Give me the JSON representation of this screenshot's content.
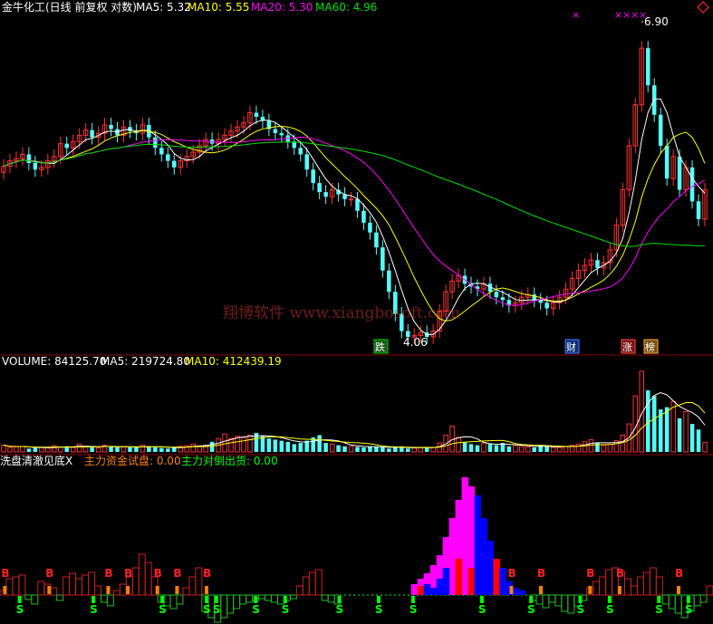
{
  "colors": {
    "up": "#ff3232",
    "down": "#54fcfc",
    "ma5": "#ffffff",
    "ma10": "#ffff00",
    "ma20": "#ff00ff",
    "ma60": "#00e000",
    "header_label": "#ffffff",
    "label_green": "#00ff00",
    "label_orange": "#ff8000",
    "label_cyan": "#54fcfc",
    "diamond_red": "#ff2020",
    "pivot_blue": "#0000ff"
  },
  "chart_data": [
    {
      "type": "candlestick",
      "title": "金牛化工(日线 前复权 对数)",
      "scale": "log",
      "ylim": [
        4.06,
        6.9
      ],
      "ma_legend": [
        {
          "name": "MA5",
          "value": "5.32",
          "color": "#ffffff"
        },
        {
          "name": "MA10",
          "value": "5.55",
          "color": "#ffff00"
        },
        {
          "name": "MA20",
          "value": "5.30",
          "color": "#ff00ff"
        },
        {
          "name": "MA60",
          "value": "4.96",
          "color": "#00e000"
        }
      ],
      "high_label": "6.90",
      "low_label": "4.06",
      "close": [
        5.41,
        5.46,
        5.48,
        5.52,
        5.44,
        5.38,
        5.4,
        5.46,
        5.5,
        5.62,
        5.58,
        5.64,
        5.7,
        5.75,
        5.68,
        5.72,
        5.8,
        5.76,
        5.7,
        5.78,
        5.74,
        5.72,
        5.8,
        5.68,
        5.58,
        5.52,
        5.46,
        5.4,
        5.46,
        5.5,
        5.54,
        5.6,
        5.66,
        5.62,
        5.66,
        5.7,
        5.74,
        5.78,
        5.82,
        5.92,
        5.88,
        5.84,
        5.76,
        5.72,
        5.7,
        5.64,
        5.58,
        5.52,
        5.38,
        5.26,
        5.18,
        5.14,
        5.2,
        5.16,
        5.12,
        5.12,
        5.02,
        4.92,
        4.84,
        4.72,
        4.54,
        4.38,
        4.22,
        4.1,
        4.06,
        4.07,
        4.09,
        4.06,
        4.1,
        4.24,
        4.38,
        4.46,
        4.5,
        4.44,
        4.42,
        4.4,
        4.44,
        4.38,
        4.34,
        4.32,
        4.28,
        4.3,
        4.34,
        4.36,
        4.32,
        4.3,
        4.26,
        4.3,
        4.34,
        4.4,
        4.48,
        4.54,
        4.58,
        4.62,
        4.56,
        4.6,
        4.7,
        4.9,
        5.2,
        5.6,
        6.0,
        6.6,
        6.2,
        5.9,
        5.6,
        5.3,
        5.5,
        5.2,
        5.4,
        5.1,
        4.95,
        5.2
      ],
      "volume": {
        "legend": [
          {
            "name": "VOLUME",
            "value": "84125.70",
            "color": "#ffffff"
          },
          {
            "name": "MA5",
            "value": "219724.80",
            "color": "#ffffff"
          },
          {
            "name": "MA10",
            "value": "412439.19",
            "color": "#ffff00"
          }
        ],
        "values": [
          60,
          40,
          45,
          50,
          30,
          35,
          40,
          35,
          55,
          45,
          50,
          40,
          70,
          45,
          40,
          35,
          60,
          50,
          40,
          45,
          40,
          40,
          60,
          50,
          40,
          35,
          30,
          40,
          50,
          55,
          70,
          50,
          60,
          90,
          120,
          160,
          120,
          140,
          130,
          150,
          170,
          140,
          120,
          110,
          100,
          90,
          70,
          80,
          100,
          130,
          150,
          80,
          70,
          60,
          50,
          50,
          45,
          40,
          50,
          45,
          40,
          30,
          40,
          50,
          30,
          35,
          40,
          45,
          40,
          80,
          150,
          230,
          130,
          90,
          70,
          60,
          80,
          70,
          60,
          80,
          50,
          60,
          50,
          45,
          40,
          60,
          50,
          40,
          40,
          50,
          60,
          70,
          90,
          110,
          80,
          60,
          70,
          100,
          150,
          250,
          500,
          720,
          550,
          500,
          380,
          400,
          450,
          300,
          360,
          250,
          200,
          84
        ]
      }
    },
    {
      "type": "bar",
      "title": "洗盘清澈见底X",
      "indicators": [
        {
          "name": "主力资金试盘",
          "value": "0.00",
          "color": "#ff8000"
        },
        {
          "name": "主力对倒出货",
          "value": "0.00",
          "color": "#00ff00"
        }
      ],
      "buy_label": "B",
      "sell_label": "S",
      "marker_chars": [
        "跌",
        "财",
        "涨",
        "榜"
      ],
      "magenta": [
        0,
        0,
        0,
        0,
        0,
        0,
        0,
        0,
        0,
        0,
        0,
        0,
        0,
        0,
        0,
        0,
        0,
        0,
        0,
        0,
        0,
        0,
        0,
        0,
        0,
        0,
        0,
        0,
        0,
        0,
        0,
        0,
        0,
        0,
        0,
        0,
        0,
        0,
        0,
        0,
        0,
        0,
        0,
        0,
        0,
        0,
        0,
        0,
        0,
        0,
        0,
        0,
        0,
        0,
        0,
        0,
        0,
        0,
        0,
        0,
        0,
        0,
        0,
        0,
        0,
        12,
        18,
        24,
        33,
        44,
        64,
        85,
        105,
        130,
        120,
        95,
        40,
        10,
        0,
        0,
        0,
        0,
        0,
        0,
        0,
        0,
        0,
        0,
        0,
        0,
        0,
        0,
        0,
        0,
        0,
        0,
        0,
        0,
        0,
        0,
        0,
        0,
        0,
        0,
        0,
        0,
        0,
        0,
        0,
        0,
        0,
        0
      ],
      "blue_red_bars": [
        {
          "i": 66,
          "h": 10,
          "c": "red"
        },
        {
          "i": 67,
          "h": 12,
          "c": "blue"
        },
        {
          "i": 68,
          "h": 8,
          "c": "blue"
        },
        {
          "i": 69,
          "h": 18,
          "c": "blue"
        },
        {
          "i": 70,
          "h": 30,
          "c": "blue"
        },
        {
          "i": 72,
          "h": 40,
          "c": "red"
        },
        {
          "i": 74,
          "h": 30,
          "c": "red"
        },
        {
          "i": 75,
          "h": 110,
          "c": "blue"
        },
        {
          "i": 76,
          "h": 85,
          "c": "blue"
        },
        {
          "i": 77,
          "h": 60,
          "c": "blue"
        },
        {
          "i": 78,
          "h": 40,
          "c": "red"
        },
        {
          "i": 79,
          "h": 30,
          "c": "blue"
        },
        {
          "i": 80,
          "h": 15,
          "c": "blue"
        },
        {
          "i": 81,
          "h": 8,
          "c": "blue"
        },
        {
          "i": 82,
          "h": 5,
          "c": "blue"
        }
      ],
      "hollow": [
        5,
        18,
        20,
        22,
        -5,
        -10,
        15,
        12,
        8,
        -6,
        20,
        24,
        18,
        22,
        25,
        10,
        -8,
        -12,
        5,
        12,
        20,
        30,
        45,
        36,
        20,
        -8,
        -12,
        -15,
        -10,
        8,
        20,
        30,
        -18,
        -25,
        -30,
        -25,
        -20,
        -15,
        -10,
        -8,
        -6,
        -4,
        -6,
        -8,
        -10,
        -6,
        -4,
        10,
        20,
        25,
        28,
        -6,
        -8,
        -10,
        0,
        0,
        0,
        0,
        0,
        0,
        0,
        0,
        0,
        0,
        0,
        0,
        0,
        0,
        0,
        0,
        0,
        0,
        0,
        0,
        0,
        0,
        0,
        0,
        0,
        0,
        0,
        0,
        0,
        0,
        -6,
        -10,
        -14,
        -8,
        -12,
        -18,
        -20,
        -12,
        -6,
        8,
        15,
        20,
        28,
        30,
        26,
        18,
        10,
        20,
        25,
        30,
        20,
        -10,
        -15,
        -20,
        -25,
        -18,
        -12,
        -8,
        10
      ],
      "buy_points": [
        1,
        10,
        22,
        26,
        32,
        36,
        42,
        104,
        110,
        120,
        126,
        138
      ],
      "sell_points": [
        4,
        19,
        33,
        42,
        44,
        52,
        58,
        69,
        77,
        84,
        98,
        108,
        118,
        124,
        134,
        140
      ]
    }
  ],
  "watermark": "翔博软件 www.xiangbosoft.com"
}
